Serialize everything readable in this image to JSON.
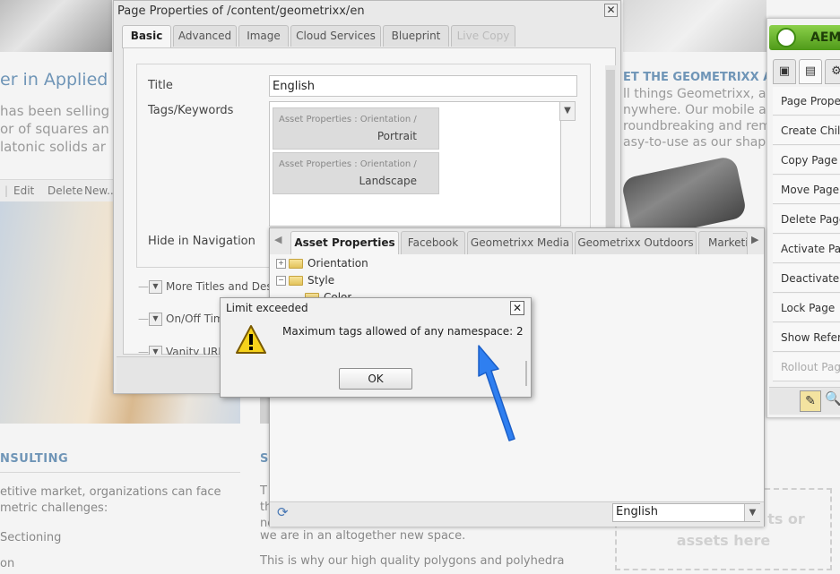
{
  "background_page": {
    "heading": "er in Applied",
    "paragraph_lines": [
      "has been selling",
      "or of squares an",
      "latonic solids ar"
    ],
    "toolbar": [
      "Edit",
      "Delete",
      "New..."
    ],
    "consulting_heading": "NSULTING",
    "consulting_text_lines": [
      "etitive market, organizations can face",
      "metric challenges:"
    ],
    "sectioning": "Sectioning",
    "on_item": "on",
    "mid_heading": "S",
    "mid_text_lines": [
      "T",
      "th",
      "ne"
    ],
    "mid_sentence1": "we are in an altogether new space.",
    "mid_sentence2": "This is why our high quality polygons and polyhedra",
    "right_heading": "ET THE GEOMETRIXX A",
    "right_text_lines": [
      "ll things Geometrixx, a",
      "nywhere. Our mobile ap",
      "roundbreaking and rem",
      "asy-to-use as our shap"
    ],
    "drop_zone_lines": [
      "ts or",
      "assets here"
    ]
  },
  "sidekick": {
    "title": "AEM",
    "tabs": [
      "components-icon",
      "page-icon",
      "gear-icon"
    ],
    "items": [
      {
        "label": "Page Proper",
        "enabled": true
      },
      {
        "label": "Create Child",
        "enabled": true
      },
      {
        "label": "Copy Page",
        "enabled": true
      },
      {
        "label": "Move Page",
        "enabled": true
      },
      {
        "label": "Delete Page",
        "enabled": true
      },
      {
        "label": "Activate Pag",
        "enabled": true
      },
      {
        "label": "Deactivate P",
        "enabled": true
      },
      {
        "label": "Lock Page",
        "enabled": true
      },
      {
        "label": "Show Refere",
        "enabled": true
      },
      {
        "label": "Rollout Page",
        "enabled": false
      }
    ]
  },
  "page_properties": {
    "title": "Page Properties of /content/geometrixx/en",
    "tabs": [
      {
        "label": "Basic",
        "active": true,
        "enabled": true
      },
      {
        "label": "Advanced",
        "active": false,
        "enabled": true
      },
      {
        "label": "Image",
        "active": false,
        "enabled": true
      },
      {
        "label": "Cloud Services",
        "active": false,
        "enabled": true
      },
      {
        "label": "Blueprint",
        "active": false,
        "enabled": true
      },
      {
        "label": "Live Copy",
        "active": false,
        "enabled": false
      }
    ],
    "fields": {
      "title_label": "Title",
      "title_value": "English",
      "tags_label": "Tags/Keywords",
      "hide_nav_label": "Hide in Navigation"
    },
    "tags": [
      {
        "path": "Asset Properties : Orientation  /",
        "name": "Portrait"
      },
      {
        "path": "Asset Properties : Orientation  /",
        "name": "Landscape"
      }
    ],
    "collapsible_sections": [
      "More Titles and Descr",
      "On/Off Tim",
      "Vanity URL"
    ]
  },
  "tag_picker": {
    "tabs": [
      {
        "label": "Asset Properties",
        "active": true
      },
      {
        "label": "Facebook",
        "active": false
      },
      {
        "label": "Geometrixx Media",
        "active": false
      },
      {
        "label": "Geometrixx Outdoors",
        "active": false
      },
      {
        "label": "Marketin",
        "active": false
      }
    ],
    "tree": [
      {
        "label": "Orientation",
        "expanded": false
      },
      {
        "label": "Style",
        "expanded": true
      },
      {
        "label": "Color",
        "expanded": false
      }
    ],
    "language": "English"
  },
  "alert": {
    "title": "Limit exceeded",
    "message": "Maximum tags allowed of any namespace: 2",
    "ok_label": "OK",
    "icon": "warning-icon"
  },
  "colors": {
    "accent_blue": "#6f95b7",
    "sidekick_green": "#5faa22",
    "annotation_arrow": "#2f7ff0"
  }
}
